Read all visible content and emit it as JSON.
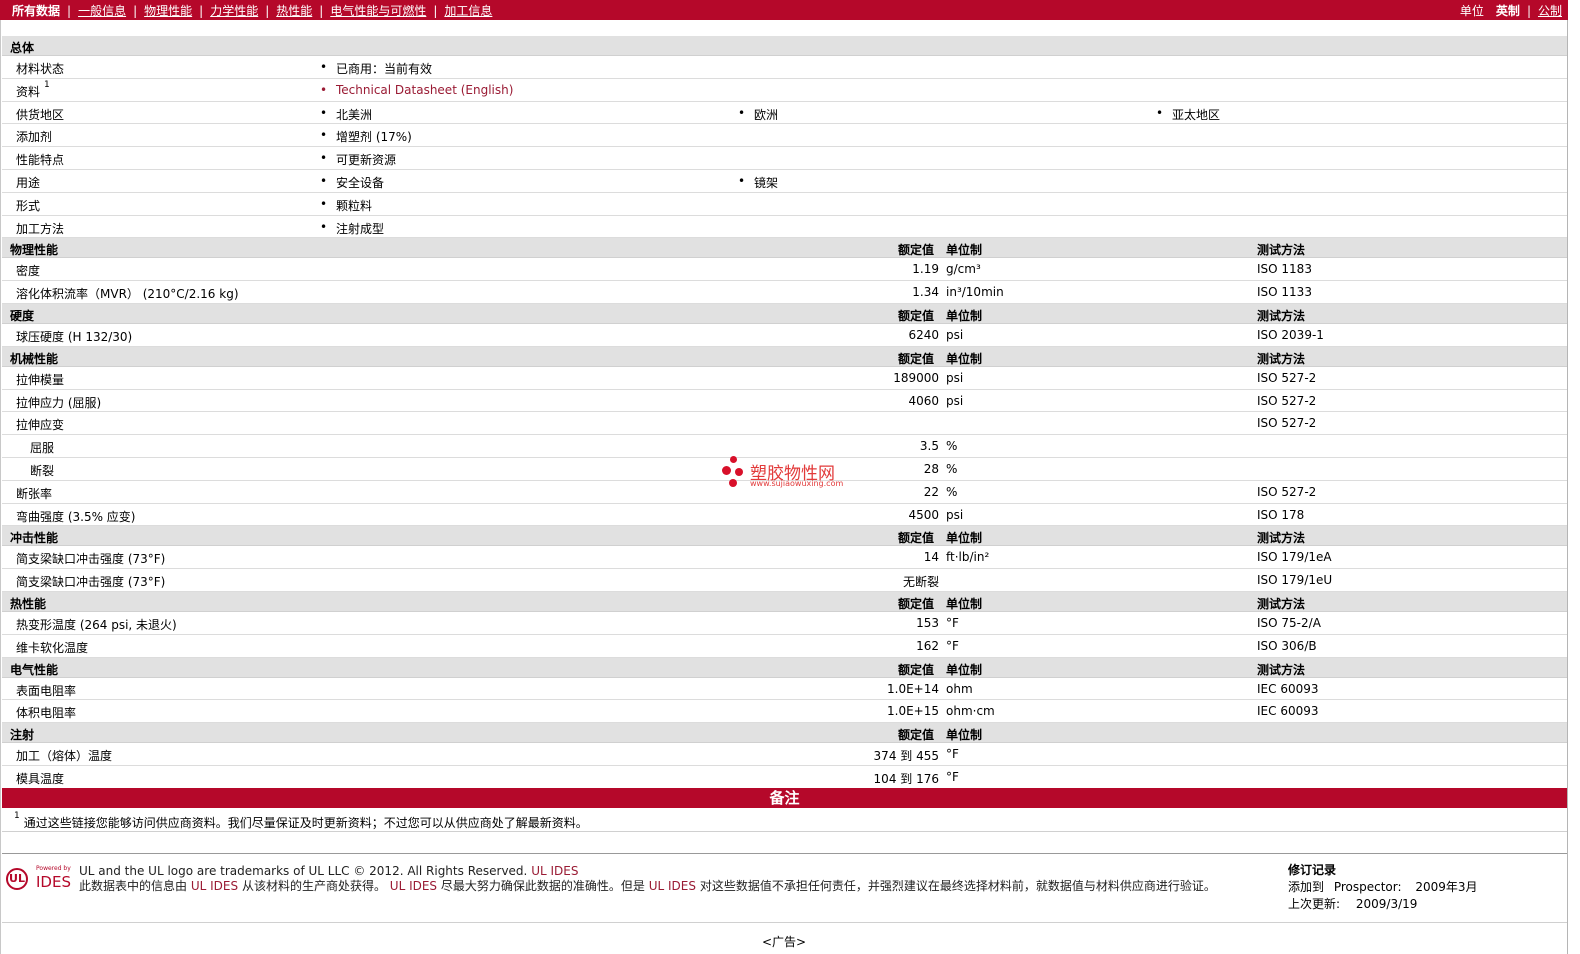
{
  "nav": {
    "items": [
      "所有数据",
      "一般信息",
      "物理性能",
      "力学性能",
      "热性能",
      "电气性能与可燃性",
      "加工信息"
    ],
    "unit_label": "单位",
    "unit_imperial": "英制",
    "unit_metric": "公制"
  },
  "general": {
    "title": "总体",
    "status_label": "材料状态",
    "status_value": "已商用：当前有效",
    "doc_label": "资料",
    "doc_sup": "1",
    "doc_value": "Technical Datasheet (English)",
    "region_label": "供货地区",
    "region_values": [
      "北美洲",
      "欧洲",
      "亚太地区"
    ],
    "additive_label": "添加剂",
    "additive_value": "增塑剂 (17%)",
    "feature_label": "性能特点",
    "feature_value": "可更新资源",
    "use_label": "用途",
    "use_values": [
      "安全设备",
      "镜架"
    ],
    "form_label": "形式",
    "form_value": "颗粒料",
    "process_label": "加工方法",
    "process_value": "注射成型"
  },
  "headers": {
    "value": "额定值",
    "unit": "单位制",
    "test": "测试方法"
  },
  "physical": {
    "title": "物理性能",
    "rows": [
      {
        "label": "密度",
        "value": "1.19",
        "unit": "g/cm³",
        "test": "ISO 1183"
      },
      {
        "label": "溶化体积流率（MVR） (210°C/2.16 kg)",
        "value": "1.34",
        "unit": "in³/10min",
        "test": "ISO 1133"
      }
    ]
  },
  "hardness": {
    "title": "硬度",
    "rows": [
      {
        "label": "球压硬度 (H 132/30)",
        "value": "6240",
        "unit": "psi",
        "test": "ISO 2039-1"
      }
    ]
  },
  "mechanical": {
    "title": "机械性能",
    "rows": [
      {
        "label": "拉伸模量",
        "value": "189000",
        "unit": "psi",
        "test": "ISO 527-2"
      },
      {
        "label": "拉伸应力 (屈服)",
        "value": "4060",
        "unit": "psi",
        "test": "ISO 527-2"
      },
      {
        "label": "拉伸应变",
        "value": "",
        "unit": "",
        "test": "ISO 527-2"
      },
      {
        "label": "屈服",
        "value": "3.5",
        "unit": "%",
        "test": ""
      },
      {
        "label": "断裂",
        "value": "28",
        "unit": "%",
        "test": ""
      },
      {
        "label": "断张率",
        "value": "22",
        "unit": "%",
        "test": "ISO 527-2"
      },
      {
        "label": "弯曲强度 (3.5% 应变)",
        "value": "4500",
        "unit": "psi",
        "test": "ISO 178"
      }
    ]
  },
  "impact": {
    "title": "冲击性能",
    "rows": [
      {
        "label": "简支梁缺口冲击强度 (73°F)",
        "value": "14",
        "unit": "ft·lb/in²",
        "test": "ISO 179/1eA"
      },
      {
        "label": "简支梁缺口冲击强度 (73°F)",
        "value": "无断裂",
        "unit": "",
        "test": "ISO 179/1eU"
      }
    ]
  },
  "thermal": {
    "title": "热性能",
    "rows": [
      {
        "label": "热变形温度 (264 psi, 未退火)",
        "value": "153",
        "unit": "°F",
        "test": "ISO 75-2/A"
      },
      {
        "label": "维卡软化温度",
        "value": "162",
        "unit": "°F",
        "test": "ISO 306/B"
      }
    ]
  },
  "electrical": {
    "title": "电气性能",
    "rows": [
      {
        "label": "表面电阻率",
        "value": "1.0E+14",
        "unit": "ohm",
        "test": "IEC 60093"
      },
      {
        "label": "体积电阻率",
        "value": "1.0E+15",
        "unit": "ohm·cm",
        "test": "IEC 60093"
      }
    ]
  },
  "injection": {
    "title": "注射",
    "rows": [
      {
        "label": "加工（熔体）温度",
        "value": "374 到 455",
        "unit": "°F"
      },
      {
        "label": "模具温度",
        "value": "104 到 176",
        "unit": "°F"
      }
    ]
  },
  "notes": {
    "title": "备注",
    "footnote_sup": "1",
    "footnote": "通过这些链接您能够访问供应商资料。我们尽量保证及时更新资料；不过您可以从供应商处了解最新资料。"
  },
  "footer": {
    "logo_ul": "UL",
    "logo_powered": "Powered by",
    "logo_ides": "IDES",
    "line1": "UL and the UL logo are trademarks of UL LLC © 2012. All Rights Reserved.",
    "line1_link": "UL IDES",
    "line2a": "此数据表中的信息由",
    "line2_link1": "UL IDES",
    "line2b": "从该材料的生产商处获得。",
    "line2_link2": "UL IDES",
    "line2c": "尽最大努力确保此数据的准确性。但是",
    "line2_link3": "UL IDES",
    "line2d": "对这些数据值不承担任何责任，并强烈建议在最终选择材料前，就数据值与材料供应商进行验证。",
    "revision_title": "修订记录",
    "added_label": "添加到",
    "added_value": "Prospector:",
    "added_date": "2009年3月",
    "updated_label": "上次更新:",
    "updated_value": "2009/3/19",
    "ad": "<广告>"
  },
  "watermark": {
    "title": "塑胶物性网",
    "url": "www.sujiaowuxing.com"
  }
}
